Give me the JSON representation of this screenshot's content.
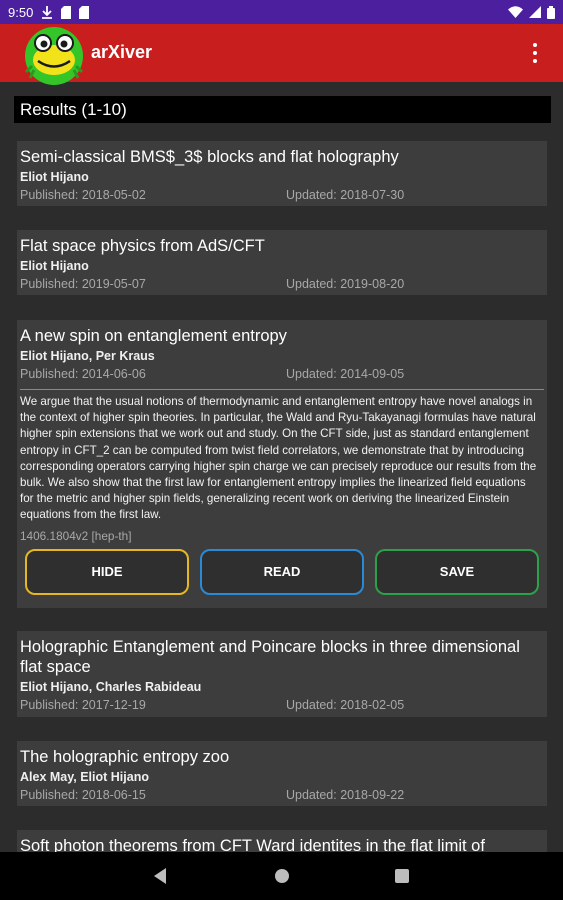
{
  "status_bar": {
    "time": "9:50",
    "icons": [
      "download-icon",
      "sd-card-icon",
      "sd-card-icon",
      "wifi-icon",
      "signal-icon",
      "battery-icon"
    ]
  },
  "app_bar": {
    "title": "arXiver",
    "logo": "frog-logo",
    "menu_icon": "overflow-menu-icon"
  },
  "results": {
    "header": "Results (1-10)",
    "items": [
      {
        "title": "Semi-classical BMS$_3$ blocks and flat holography",
        "authors": "Eliot Hijano",
        "published": "Published: 2018-05-02",
        "updated": "Updated: 2018-07-30"
      },
      {
        "title": "Flat space physics from AdS/CFT",
        "authors": "Eliot Hijano",
        "published": "Published: 2019-05-07",
        "updated": "Updated: 2019-08-20"
      },
      {
        "title": "A new spin on entanglement entropy",
        "authors": "Eliot Hijano, Per Kraus",
        "published": "Published: 2014-06-06",
        "updated": "Updated: 2014-09-05",
        "abstract": "  We argue that the usual notions of thermodynamic and entanglement entropy have novel analogs in the context of higher spin theories. In particular, the Wald and Ryu-Takayanagi formulas have natural higher spin extensions that we work out and study. On the CFT side, just as standard entanglement entropy in CFT_2 can be computed from twist field correlators, we demonstrate that by introducing corresponding operators carrying higher spin charge we can precisely reproduce our results from the bulk.   We also show that the first law for entanglement entropy implies the linearized field equations for the metric and higher spin fields, generalizing recent work on deriving the linearized Einstein equations from the first law.",
        "arxiv_id": "1406.1804v2 [hep-th]",
        "buttons": {
          "hide": "HIDE",
          "read": "READ",
          "save": "SAVE"
        }
      },
      {
        "title": "Holographic Entanglement and Poincare blocks in three dimensional flat  space",
        "authors": "Eliot Hijano, Charles Rabideau",
        "published": "Published: 2017-12-19",
        "updated": "Updated: 2018-02-05"
      },
      {
        "title": "The holographic entropy zoo",
        "authors": "Alex May, Eliot Hijano",
        "published": "Published: 2018-06-15",
        "updated": "Updated: 2018-09-22"
      },
      {
        "title": "Soft photon theorems from CFT Ward identites in the flat limit of"
      }
    ]
  },
  "colors": {
    "status_bar": "#4b1f9e",
    "app_bar": "#c81e1e",
    "card": "#3d3d3d",
    "background": "#2c2c2c",
    "hide_border": "#e5b722",
    "read_border": "#2a8ad6",
    "save_border": "#2ea048"
  },
  "nav_bar": {
    "icons": [
      "back-icon",
      "home-icon",
      "recents-icon"
    ]
  }
}
